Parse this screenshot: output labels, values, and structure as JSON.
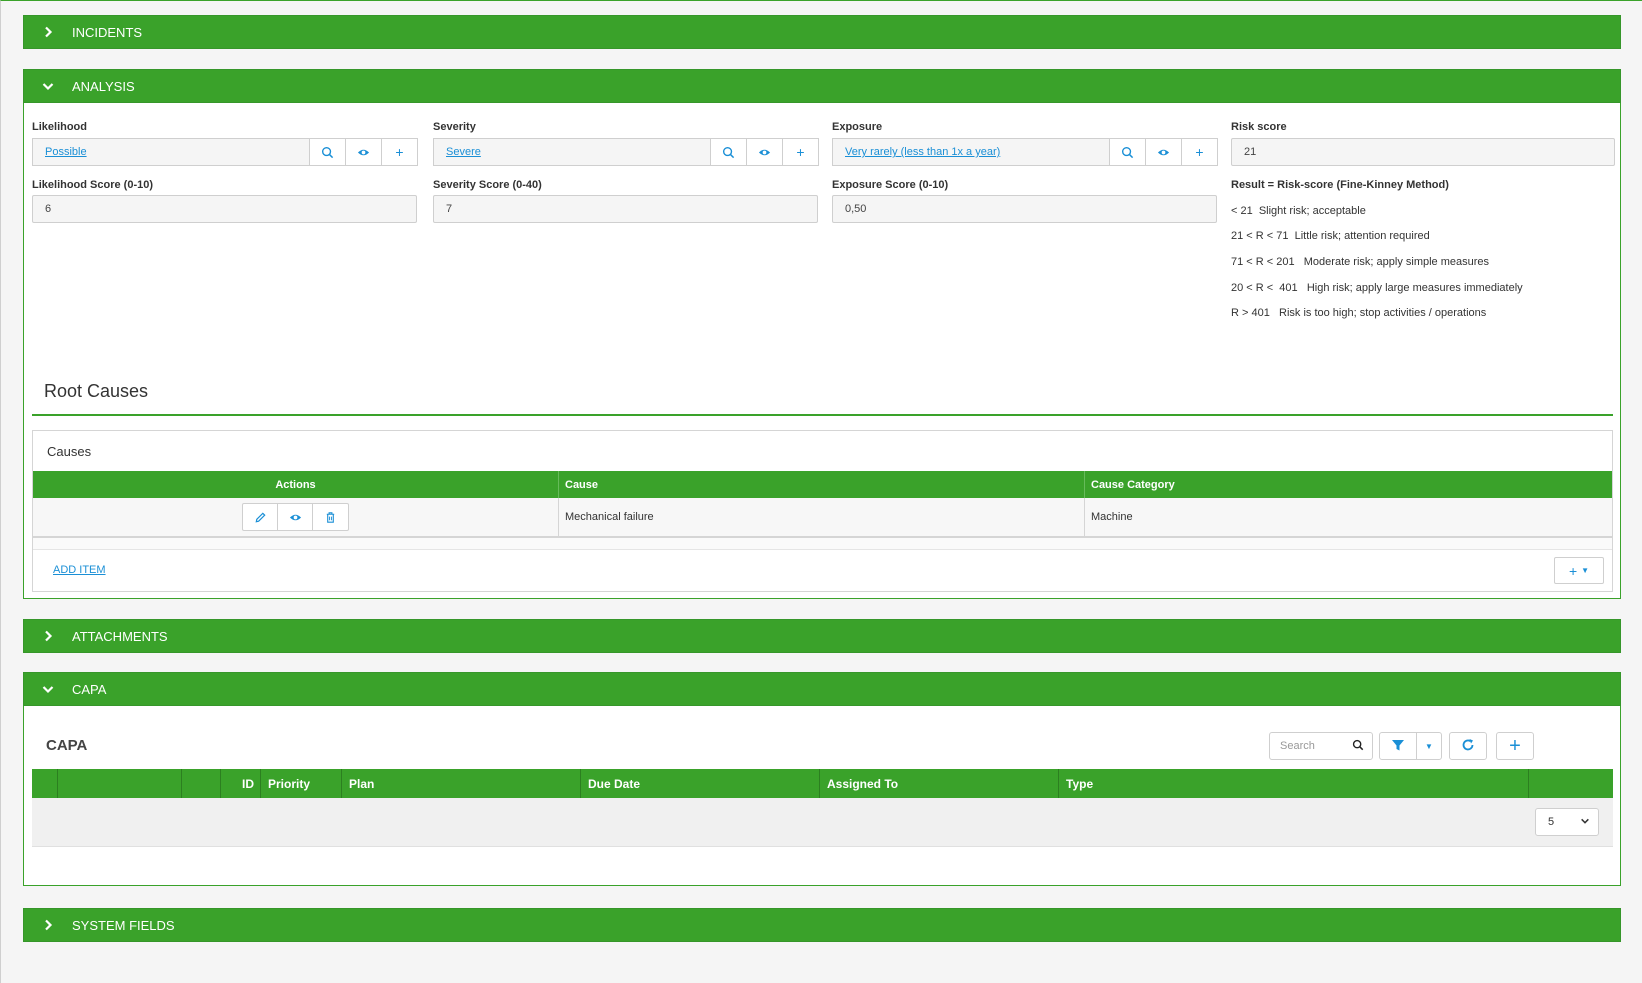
{
  "incidents": {
    "title": "INCIDENTS"
  },
  "analysis": {
    "title": "ANALYSIS",
    "likelihood": {
      "label": "Likelihood",
      "value": "Possible"
    },
    "severity": {
      "label": "Severity",
      "value": "Severe"
    },
    "exposure": {
      "label": "Exposure",
      "value": "Very rarely (less than 1x a year)"
    },
    "risk_score": {
      "label": "Risk score",
      "value": "21"
    },
    "likelihood_score": {
      "label": "Likelihood Score (0-10)",
      "value": "6"
    },
    "severity_score": {
      "label": "Severity Score (0-40)",
      "value": "7"
    },
    "exposure_score": {
      "label": "Exposure Score (0-10)",
      "value": "0,50"
    },
    "result_legend": {
      "title": "Result = Risk-score (Fine-Kinney Method)",
      "lines": [
        "< 21  Slight risk; acceptable",
        "21 < R < 71  Little risk; attention required",
        "71 < R < 201   Moderate risk; apply simple measures",
        "20 < R <  401   High risk; apply large measures immediately",
        "R > 401   Risk is too high; stop activities / operations"
      ]
    },
    "root_causes": {
      "heading": "Root Causes",
      "box_title": "Causes",
      "columns": [
        "Actions",
        "Cause",
        "Cause Category"
      ],
      "rows": [
        {
          "cause": "Mechanical failure",
          "category": "Machine"
        }
      ],
      "add_item": "ADD ITEM"
    }
  },
  "attachments": {
    "title": "ATTACHMENTS"
  },
  "capa": {
    "title": "CAPA",
    "heading": "CAPA",
    "search_placeholder": "Search",
    "columns": [
      "",
      "",
      "",
      "ID",
      "Priority",
      "Plan",
      "Due Date",
      "Assigned To",
      "Type",
      ""
    ],
    "page_size": "5"
  },
  "system_fields": {
    "title": "SYSTEM FIELDS"
  },
  "colors": {
    "primary": "#3aa22a",
    "link": "#1a8fd6"
  }
}
